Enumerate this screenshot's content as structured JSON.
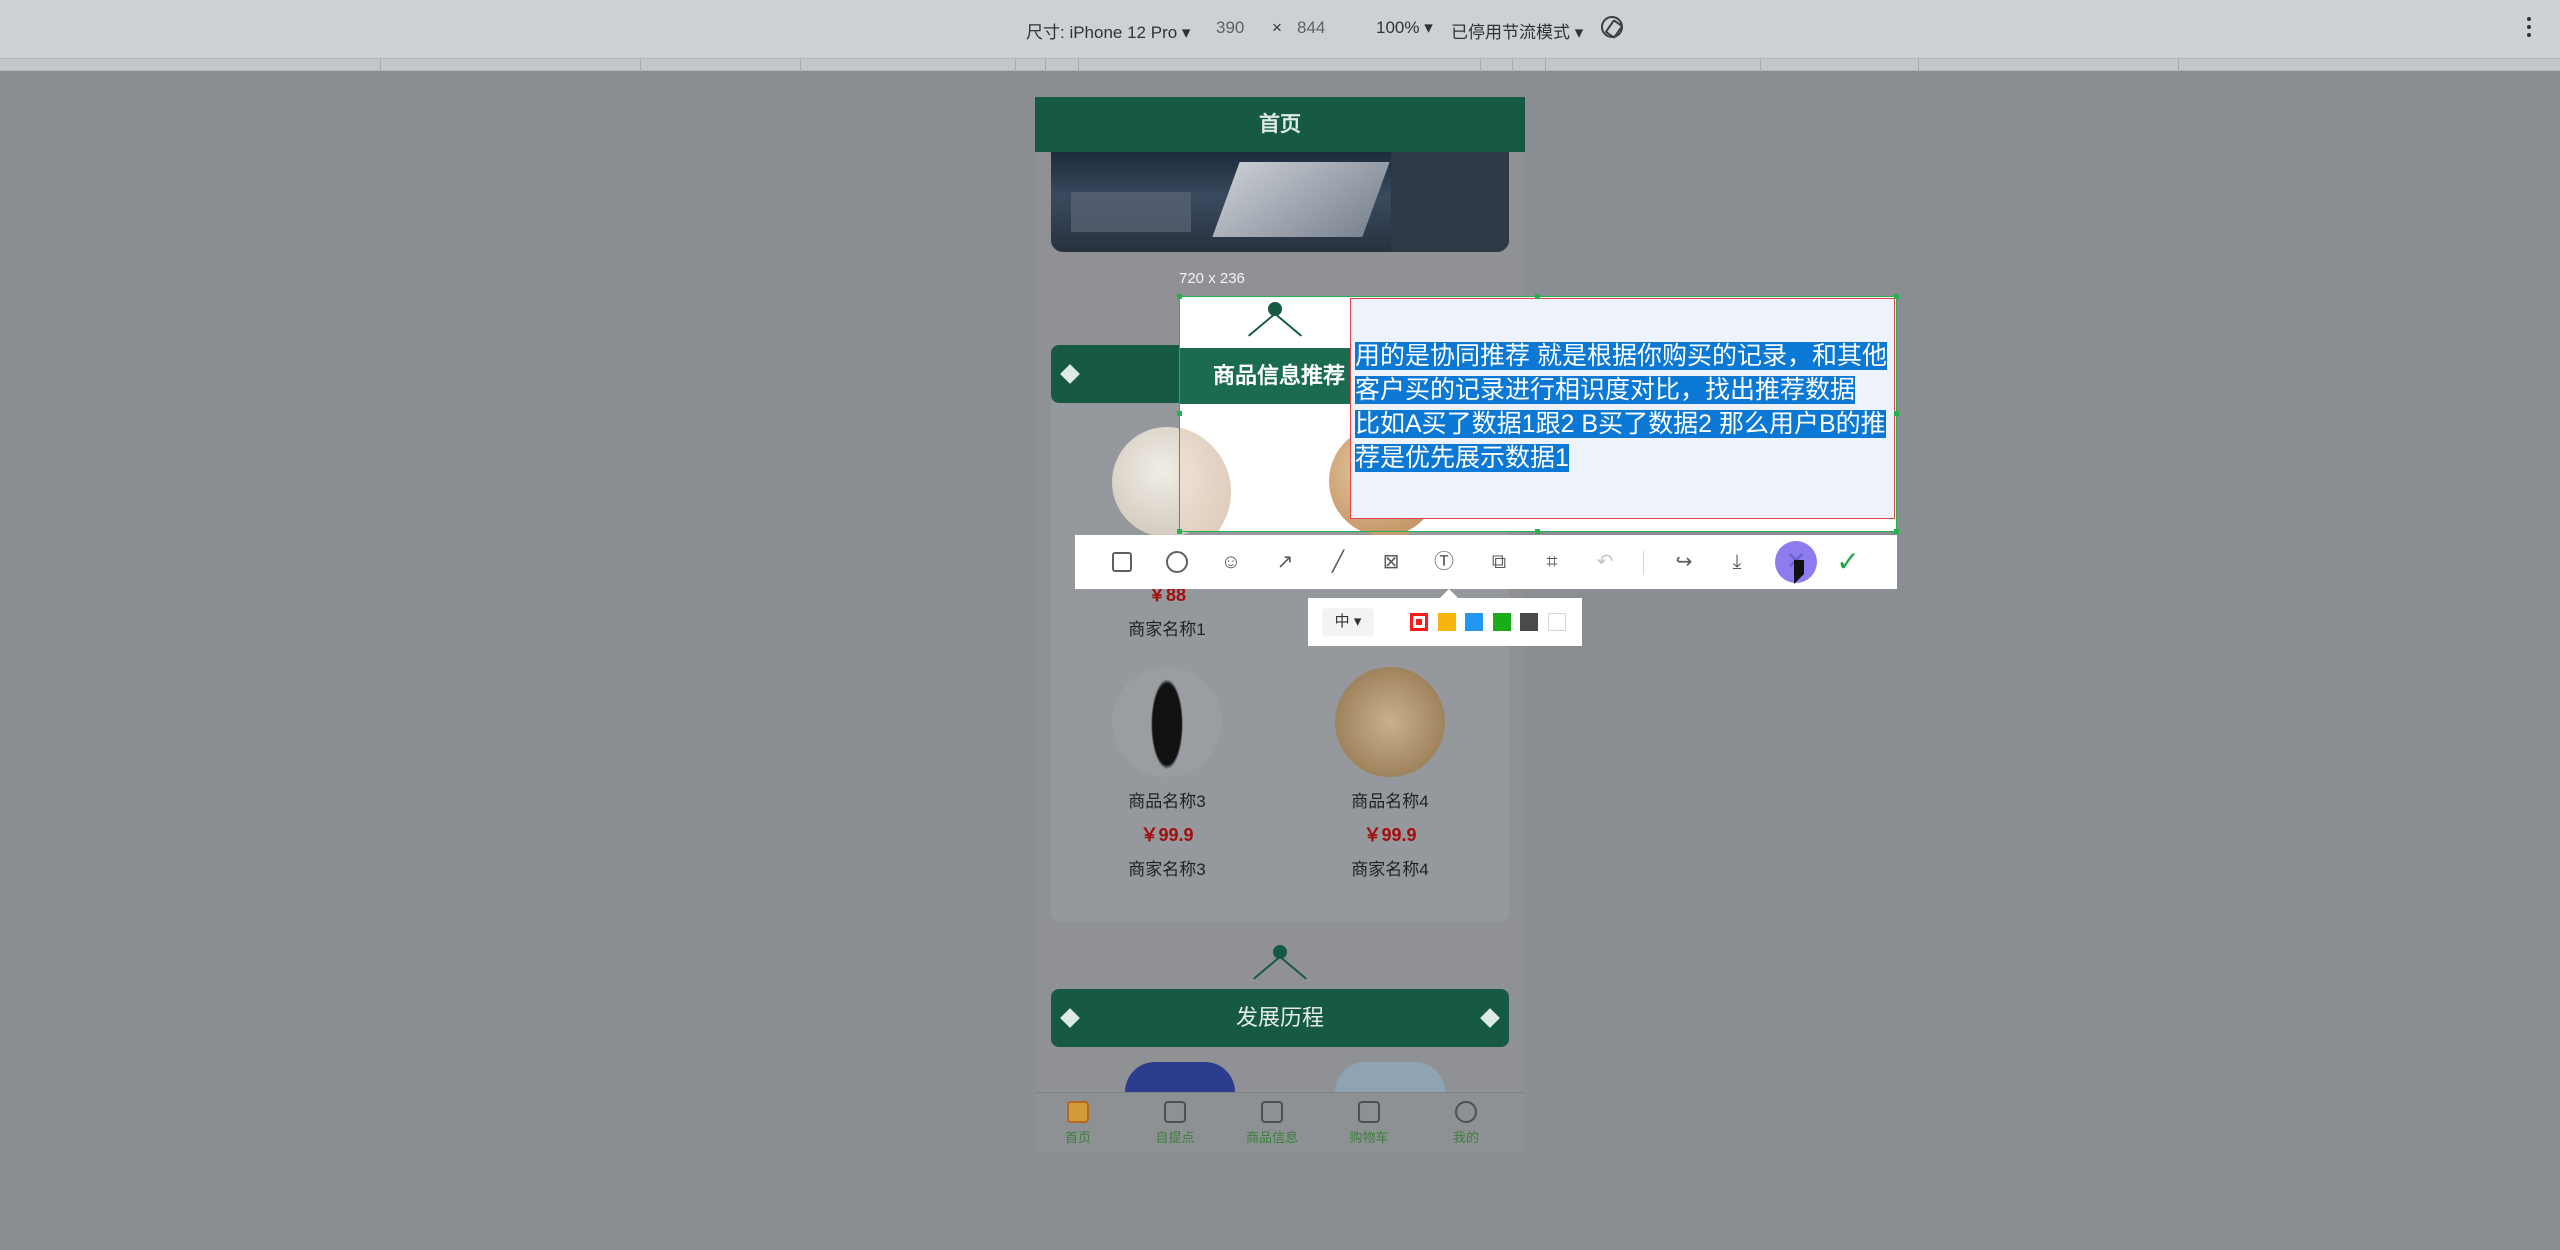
{
  "devtools": {
    "device_label": "尺寸: iPhone 12 Pro ▾",
    "width": "390",
    "times": "×",
    "height": "844",
    "zoom": "100% ▾",
    "throttle": "已停用节流模式 ▾"
  },
  "app": {
    "header_title": "首页",
    "section1_title": "商品信息推荐",
    "section2_title": "发展历程",
    "products": [
      {
        "name": "",
        "price": "￥88",
        "shop": "商家名称1"
      },
      {
        "name": "商品名称3",
        "price": "￥99.9",
        "shop": "商家名称3"
      },
      {
        "name": "商品名称4",
        "price": "￥99.9",
        "shop": "商家名称4"
      }
    ],
    "tabs": [
      "首页",
      "自提点",
      "商品信息",
      "购物车",
      "我的"
    ]
  },
  "screenshot_tool": {
    "size_label": "720 x 236",
    "annotation_line1": "用的是协同推荐  就是根据你购买的记录，和其他客户买的记录进行相识度对比，找出推荐数据",
    "annotation_line2": "比如A买了数据1跟2  B买了数据2  那么用户B的推荐是优先展示数据1",
    "font_size_option": "中",
    "colors": [
      "#ff1a1a",
      "#f7b50e",
      "#2196f3",
      "#1aad19",
      "#4a4a4a",
      "#ffffff"
    ],
    "tools": [
      "rect-icon",
      "ellipse-icon",
      "emoji-icon",
      "arrow-icon",
      "pen-icon",
      "mosaic-icon",
      "text-icon",
      "pin-icon",
      "ocr-icon",
      "undo-icon",
      "share-icon",
      "save-icon",
      "cancel-icon",
      "confirm-icon"
    ]
  }
}
